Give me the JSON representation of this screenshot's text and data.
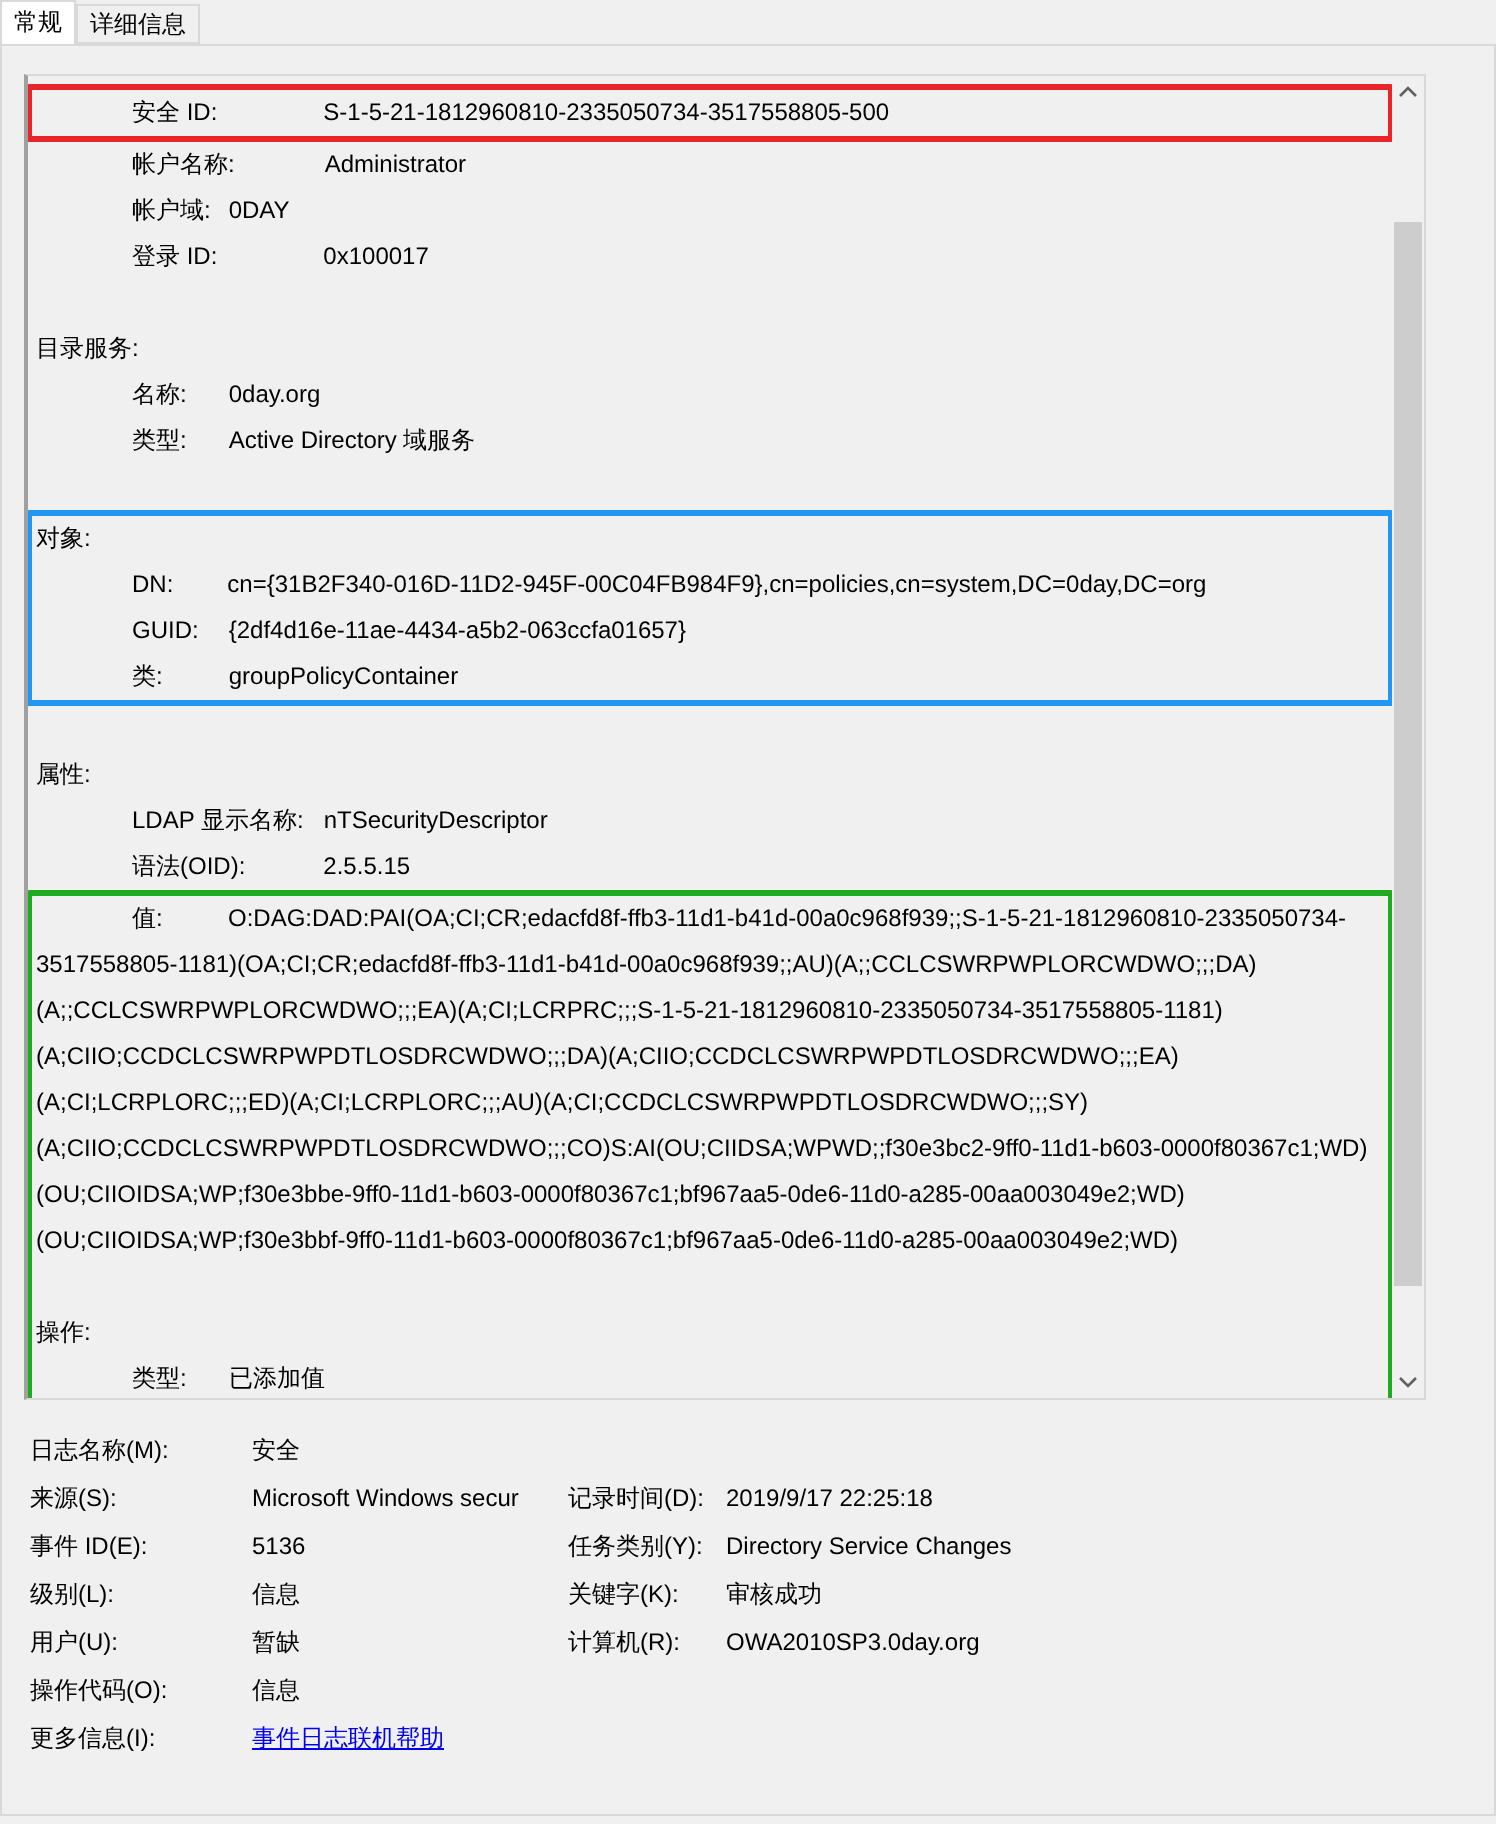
{
  "tabs": [
    {
      "label": "常规",
      "selected": true
    },
    {
      "label": "详细信息",
      "selected": false
    }
  ],
  "description": {
    "blocks": [
      {
        "color": "#e8262a",
        "items": [
          {
            "kind": "field",
            "label": "安全 ID:",
            "value": "S-1-5-21-1812960810-2335050734-3517558805-500"
          }
        ]
      },
      {
        "items": [
          {
            "kind": "field",
            "label": "帐户名称:",
            "value": "Administrator"
          },
          {
            "kind": "field",
            "label": "帐户域:",
            "value": "0DAY"
          },
          {
            "kind": "field",
            "label": "登录 ID:",
            "value": "0x100017"
          },
          {
            "kind": "gap"
          },
          {
            "kind": "heading",
            "text": "目录服务:"
          },
          {
            "kind": "field",
            "label": "名称:",
            "value": "0day.org"
          },
          {
            "kind": "field",
            "label": "类型:",
            "value": "Active Directory 域服务"
          },
          {
            "kind": "gap"
          }
        ]
      },
      {
        "color": "#2196f3",
        "items": [
          {
            "kind": "heading",
            "text": "对象:"
          },
          {
            "kind": "field",
            "label": "DN:",
            "value": "cn={31B2F340-016D-11D2-945F-00C04FB984F9},cn=policies,cn=system,DC=0day,DC=org"
          },
          {
            "kind": "field",
            "label": "GUID:",
            "value": "{2df4d16e-11ae-4434-a5b2-063ccfa01657}"
          },
          {
            "kind": "field",
            "label": "类:",
            "value": "groupPolicyContainer"
          }
        ]
      },
      {
        "items": [
          {
            "kind": "gap"
          },
          {
            "kind": "heading",
            "text": "属性:"
          },
          {
            "kind": "field",
            "label": "LDAP 显示名称:",
            "value": "nTSecurityDescriptor"
          },
          {
            "kind": "field",
            "label": "语法(OID):",
            "value": "2.5.5.15"
          }
        ]
      },
      {
        "color": "#1faa1f",
        "items": [
          {
            "kind": "wrapped",
            "label": "值:",
            "value": "O:DAG:DAD:PAI(OA;CI;CR;edacfd8f-ffb3-11d1-b41d-00a0c968f939;;S-1-5-21-1812960810-2335050734-3517558805-1181)(OA;CI;CR;edacfd8f-ffb3-11d1-b41d-00a0c968f939;;AU)(A;;CCLCSWRPWPLORCWDWO;;;DA)(A;;CCLCSWRPWPLORCWDWO;;;EA)(A;CI;LCRPRC;;;S-1-5-21-1812960810-2335050734-3517558805-1181)(A;CIIO;CCDCLCSWRPWPDTLOSDRCWDWO;;;DA)(A;CIIO;CCDCLCSWRPWPDTLOSDRCWDWO;;;EA)(A;CI;LCRPLORC;;;ED)(A;CI;LCRPLORC;;;AU)(A;CI;CCDCLCSWRPWPDTLOSDRCWDWO;;;SY)(A;CIIO;CCDCLCSWRPWPDTLOSDRCWDWO;;;CO)S:AI(OU;CIIDSA;WPWD;;f30e3bc2-9ff0-11d1-b603-0000f80367c1;WD)(OU;CIIOIDSA;WP;f30e3bbe-9ff0-11d1-b603-0000f80367c1;bf967aa5-0de6-11d0-a285-00aa003049e2;WD)(OU;CIIOIDSA;WP;f30e3bbf-9ff0-11d1-b603-0000f80367c1;bf967aa5-0de6-11d0-a285-00aa003049e2;WD)"
          },
          {
            "kind": "gap"
          },
          {
            "kind": "heading",
            "text": "操作:"
          },
          {
            "kind": "field",
            "label": "类型:",
            "value": "已添加值"
          }
        ]
      }
    ]
  },
  "summary_rows": [
    {
      "left": {
        "label": "日志名称(M):",
        "value": "安全"
      }
    },
    {
      "left": {
        "label": "来源(S):",
        "value": "Microsoft Windows secur"
      },
      "right": {
        "label": "记录时间(D):",
        "value": "2019/9/17 22:25:18"
      }
    },
    {
      "left": {
        "label": "事件 ID(E):",
        "value": "5136"
      },
      "right": {
        "label": "任务类别(Y):",
        "value": "Directory Service Changes"
      }
    },
    {
      "left": {
        "label": "级别(L):",
        "value": "信息"
      },
      "right": {
        "label": "关键字(K):",
        "value": "审核成功"
      }
    },
    {
      "left": {
        "label": "用户(U):",
        "value": "暂缺"
      },
      "right": {
        "label": "计算机(R):",
        "value": "OWA2010SP3.0day.org"
      }
    },
    {
      "left": {
        "label": "操作代码(O):",
        "value": "信息"
      }
    },
    {
      "left": {
        "label": "更多信息(I):",
        "value": "事件日志联机帮助",
        "kind": "link"
      }
    }
  ]
}
